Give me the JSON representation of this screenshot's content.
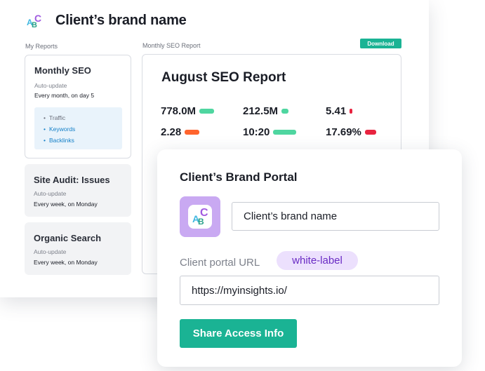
{
  "header": {
    "title": "Client’s brand name",
    "logo_letters": [
      "A",
      "B",
      "C"
    ]
  },
  "sidebar": {
    "label": "My Reports",
    "reports": [
      {
        "title": "Monthly SEO",
        "update_label": "Auto-update",
        "schedule": "Every month, on day 5",
        "metrics": [
          "Traffic",
          "Keywords",
          "Backlinks"
        ]
      },
      {
        "title": "Site Audit: Issues",
        "update_label": "Auto-update",
        "schedule": "Every week, on Monday"
      },
      {
        "title": "Organic Search",
        "update_label": "Auto-update",
        "schedule": "Every week, on Monday"
      }
    ]
  },
  "report": {
    "label": "Monthly SEO Report",
    "download_label": "Download",
    "title": "August SEO Report",
    "kpis": [
      {
        "value": "778.0M",
        "color": "#4fd6a0"
      },
      {
        "value": "212.5M",
        "color": "#4fd6a0"
      },
      {
        "value": "5.41",
        "color": "#e8233f"
      },
      {
        "value": "2.28",
        "color": "#ff642d"
      },
      {
        "value": "10:20",
        "color": "#4fd6a0"
      },
      {
        "value": "17.69%",
        "color": "#e8233f"
      }
    ]
  },
  "portal": {
    "title": "Client’s Brand Portal",
    "brand_name_value": "Client’s brand name",
    "url_label": "Client portal URL",
    "badge": "white-label",
    "url_value": "https://myinsights.io/",
    "share_label": "Share Access Info"
  },
  "colors": {
    "accent_green": "#1ab394",
    "link_blue": "#1580c8",
    "logo_purple": "#c9a9f2",
    "badge_purple": "#6a2bc4"
  }
}
